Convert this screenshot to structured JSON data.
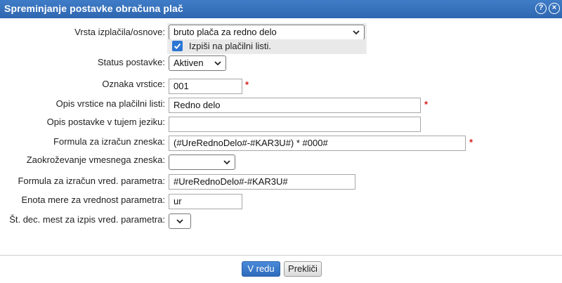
{
  "dialog": {
    "title": "Spreminjanje postavke obračuna plač",
    "help_icon": "question-circle-icon",
    "close_icon": "close-circle-icon"
  },
  "form": {
    "vrsta": {
      "label": "Vrsta izplačila/osnove:",
      "value": "bruto plača za redno delo"
    },
    "izpis_checkbox": {
      "label": "Izpiši na plačilni listi.",
      "checked": true
    },
    "status": {
      "label": "Status postavke:",
      "value": "Aktiven"
    },
    "oznaka": {
      "label": "Oznaka vrstice:",
      "value": "001",
      "required": "*"
    },
    "opis": {
      "label": "Opis vrstice na plačilni listi:",
      "value": "Redno delo",
      "required": "*"
    },
    "opis_tuj": {
      "label": "Opis postavke v tujem jeziku:",
      "value": ""
    },
    "formula": {
      "label": "Formula za izračun zneska:",
      "value": "(#UreRednoDelo#-#KAR3U#) * #000#",
      "required": "*"
    },
    "zaokrozevanje": {
      "label": "Zaokroževanje vmesnega zneska:",
      "value": ""
    },
    "formula_param": {
      "label": "Formula za izračun vred. parametra:",
      "value": "#UreRednoDelo#-#KAR3U#"
    },
    "enota": {
      "label": "Enota mere za vrednost parametra:",
      "value": "ur"
    },
    "dec_mest": {
      "label": "Št. dec. mest za izpis vred. parametra:",
      "value": ""
    }
  },
  "buttons": {
    "ok": "V redu",
    "cancel": "Prekliči"
  },
  "colors": {
    "titlebar": "#2f67b0",
    "accent": "#2b76d4",
    "required": "#d92020"
  }
}
